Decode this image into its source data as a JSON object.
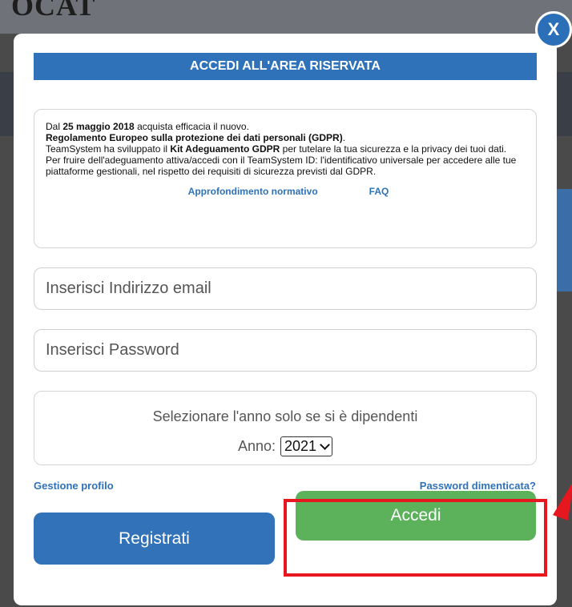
{
  "background": {
    "logo_text": "OCAT"
  },
  "modal": {
    "close_label": "X",
    "header_title": "ACCEDI ALL'AREA RISERVATA",
    "info": {
      "line1_pre": "Dal ",
      "line1_bold": "25 maggio 2018",
      "line1_post": " acquista efficacia il nuovo.",
      "line2_bold": "Regolamento Europeo sulla protezione dei dati personali (GDPR)",
      "line2_post": ".",
      "line3_pre": "TeamSystem ha sviluppato il ",
      "line3_bold": "Kit Adeguamento GDPR",
      "line3_post": " per tutelare la tua sicurezza e la privacy dei tuoi dati.",
      "line4": "Per fruire dell'adeguamento attiva/accedi con il TeamSystem ID: l'identificativo universale per accedere alle tue piattaforme gestionali, nel rispetto dei requisiti di sicurezza previsti dal GDPR.",
      "link_normativo": "Approfondimento normativo",
      "link_faq": "FAQ"
    },
    "email_placeholder": "Inserisci Indirizzo email",
    "password_placeholder": "Inserisci Password",
    "year": {
      "note": "Selezionare l'anno solo se si è dipendenti",
      "label": "Anno:",
      "selected": "2021"
    },
    "gestione_profilo": "Gestione profilo",
    "password_dimenticata": "Password dimenticata?",
    "register_label": "Registrati",
    "login_label": "Accedi"
  },
  "colors": {
    "header_blue": "#2f72b9",
    "register_blue": "#3272b8",
    "login_green": "#5cb15b",
    "highlight_red": "#e6171f"
  }
}
